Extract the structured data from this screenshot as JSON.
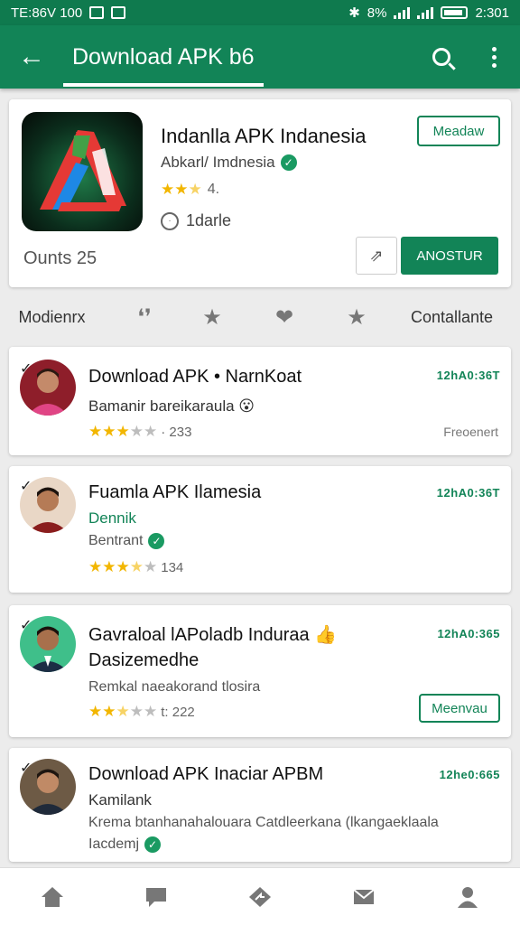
{
  "status_bar": {
    "left_text": "TE:86V 100",
    "time": "2:301",
    "percent": "8%"
  },
  "app_bar": {
    "title": "Download APK b6",
    "back_icon": "arrow-left-icon",
    "search_icon": "search-icon",
    "menu_icon": "more-vert-icon"
  },
  "hero": {
    "app_name": "Indanlla APK Indanesia",
    "developer": "Abkarl/ Imdnesia",
    "rating_text": "4.",
    "rating": 2.5,
    "size_text": "1darle",
    "counts": "Ounts  25",
    "outline_button": "Meadaw",
    "install_button": "ANOSTUR"
  },
  "tabs": {
    "left": "Modienrx",
    "right": "Contallante"
  },
  "list": [
    {
      "title": "Download APK • NarnKoat",
      "subtitle": "Bamanir bareikaraula 😮",
      "rating": 3,
      "rating_text": "· 233",
      "time": "12hA0:36T",
      "meta": "Freoenert"
    },
    {
      "title": "Fuamla APK Ilamesia",
      "subtitle": "Dennik",
      "line3": "Bentrant",
      "rating": 3.5,
      "rating_text": "134",
      "time": "12hA0:36T"
    },
    {
      "title": "Gavraloal lAPoladb Induraa 👍",
      "subtitle": "Dasizemedhe",
      "line3": "Remkal naeakorand tlosira",
      "rating": 2.5,
      "rating_text": "t: 222",
      "time": "12hA0:365",
      "button": "Meenvau"
    },
    {
      "title": "Download APK Inaciar  APBM",
      "subtitle": "Kamilank",
      "line3": "Krema btanhanahalouara Catdleerkana (lkangaeklaala",
      "line4": "Iacdemj",
      "time": "12he0:665"
    }
  ],
  "bottom_nav": [
    "home-icon",
    "chat-icon",
    "share-icon",
    "mail-icon",
    "profile-icon"
  ]
}
